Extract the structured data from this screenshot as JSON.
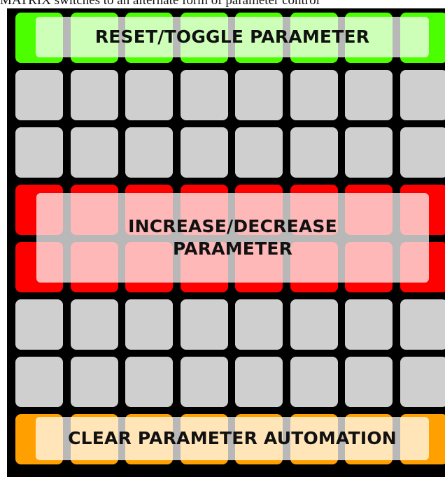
{
  "caption": {
    "text": "MATRIX switches to an alternate form of parameter control"
  },
  "grid": {
    "columns": 8,
    "rows": [
      {
        "zone": "reset",
        "color": "#4cff00"
      },
      {
        "zone": "neutral",
        "color": "#cfcfcf"
      },
      {
        "zone": "neutral",
        "color": "#cfcfcf"
      },
      {
        "zone": "adjust",
        "color": "#ff0000"
      },
      {
        "zone": "adjust",
        "color": "#ff0000"
      },
      {
        "zone": "neutral",
        "color": "#cfcfcf"
      },
      {
        "zone": "neutral",
        "color": "#cfcfcf"
      },
      {
        "zone": "clear",
        "color": "#ffa000"
      }
    ]
  },
  "zones": {
    "reset": {
      "label": "RESET/TOGGLE PARAMETER"
    },
    "adjust": {
      "label_line1": "INCREASE/DECREASE",
      "label_line2": "PARAMETER"
    },
    "clear": {
      "label": "CLEAR PARAMETER AUTOMATION"
    }
  }
}
